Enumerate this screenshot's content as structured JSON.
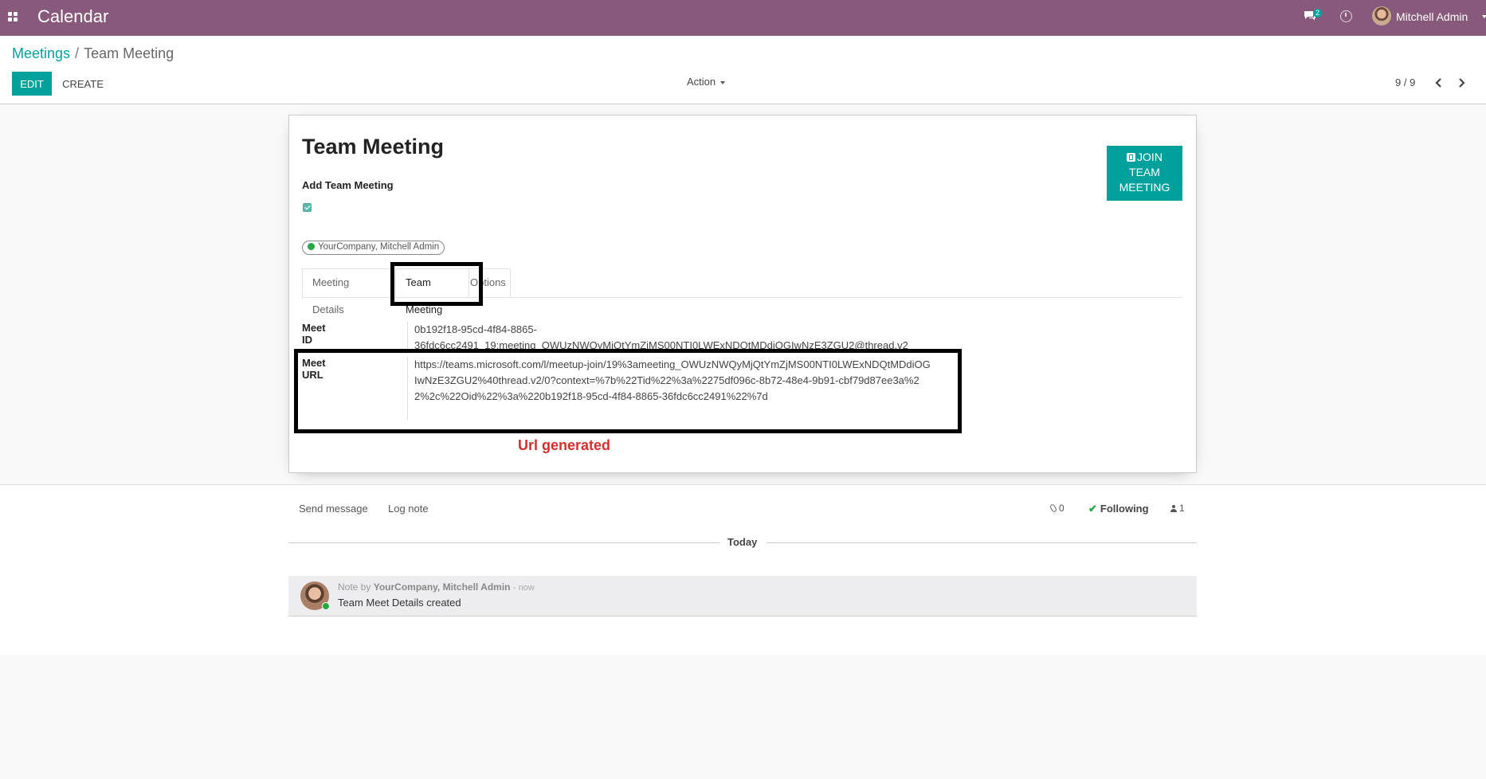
{
  "app": {
    "title": "Calendar"
  },
  "navbar": {
    "chat_badge": "2",
    "user_name": "Mitchell Admin"
  },
  "breadcrumb": {
    "parent": "Meetings",
    "separator": "/",
    "current": "Team Meeting"
  },
  "control": {
    "edit_label": "EDIT",
    "create_label": "CREATE",
    "action_label": "Action",
    "pager": "9 / 9"
  },
  "record": {
    "title": "Team Meeting",
    "join_button": [
      "JOIN",
      "TEAM",
      "MEETING"
    ],
    "add_team_meeting_label": "Add Team Meeting",
    "add_team_meeting_checked": true,
    "attendee": "YourCompany, Mitchell Admin"
  },
  "tabs": [
    {
      "label": "Meeting Details"
    },
    {
      "label": "Team Meeting",
      "active": true
    },
    {
      "label": "Options"
    }
  ],
  "fields": {
    "meet_id_label": "Meet ID",
    "meet_id_value": "0b192f18-95cd-4f84-8865-36fdc6cc2491_19:meeting_OWUzNWQyMjQtYmZjMS00NTI0LWExNDQtMDdiOGIwNzE3ZGU2@thread.v2",
    "meet_url_label": "Meet URL",
    "meet_url_value": "https://teams.microsoft.com/l/meetup-join/19%3ameeting_OWUzNWQyMjQtYmZjMS00NTI0LWExNDQtMDdiOGIwNzE3ZGU2%40thread.v2/0?context=%7b%22Tid%22%3a%2275df096c-8b72-48e4-9b91-cbf79d87ee3a%22%2c%22Oid%22%3a%220b192f18-95cd-4f84-8865-36fdc6cc2491%22%7d"
  },
  "annotation": "Url generated",
  "chatter": {
    "send_message": "Send message",
    "log_note": "Log note",
    "attachments": "0",
    "following": "Following",
    "followers": "1",
    "date_separator": "Today",
    "message": {
      "prefix": "Note by",
      "author": "YourCompany, Mitchell Admin",
      "time": "- now",
      "body": "Team Meet Details created"
    }
  },
  "colors": {
    "brand": "#875a7b",
    "primary": "#00a09d",
    "annotation": "#d42f2f",
    "highlight": "#000000"
  }
}
